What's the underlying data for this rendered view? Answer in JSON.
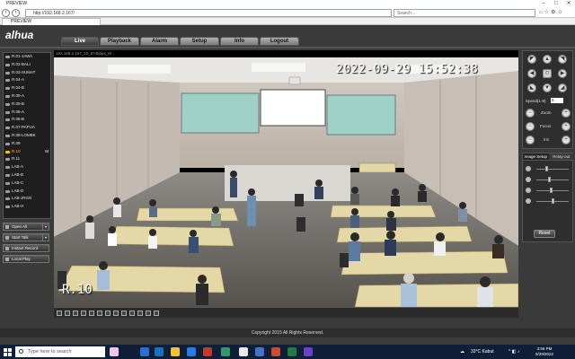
{
  "browser": {
    "window_title": "PREVIEW",
    "url": "http://192.168.2.167/",
    "search_placeholder": "Search...",
    "tab_title": "PREVIEW"
  },
  "app": {
    "logo": "alhua",
    "menu": [
      "Live",
      "Playback",
      "Alarm",
      "Setup",
      "Info",
      "Logout"
    ],
    "active_menu": "Live",
    "copyright": "Copyright 2015 All Rights Reserved."
  },
  "channels": [
    "R.01-JAWA",
    "R.02-BALI",
    "R.03-SUMAT",
    "R.04-A",
    "R.04-B",
    "R.05-A",
    "R.05-B",
    "R.06-A",
    "R.06-B",
    "R.07-PAPUA",
    "R.08-LOMBK",
    "R.09",
    "R.10",
    "R.11",
    "LAB-A",
    "LAB-B",
    "LAB-C",
    "LAB-D",
    "LAB-JRGN",
    "LAB-H"
  ],
  "selected_channel": "R.10",
  "selected_mark": "M",
  "controls": {
    "open_all": "Open All",
    "start_talk": "Start Talk",
    "instant_record": "Instant Record",
    "local_play": "Local Play"
  },
  "video": {
    "stream_label": "192.168.2.167_10_574kbps_M",
    "timestamp": "2022-09-29  15:52:38",
    "camera_name": "R.10"
  },
  "ptz": {
    "speed_label": "Speed(1-8)",
    "speed_value": "5",
    "zoom": "Zoom",
    "focus": "Focus",
    "iris": "Iris"
  },
  "image_setup": {
    "tab1": "Image Setup",
    "tab2": "Relay-out",
    "reset": "Reset",
    "levels": [
      0.3,
      0.4,
      0.45,
      0.5
    ]
  },
  "taskbar": {
    "search": "Type here to search",
    "weather": "33°C  Kabut",
    "time": "3:56 PM",
    "date": "9/29/2022"
  }
}
